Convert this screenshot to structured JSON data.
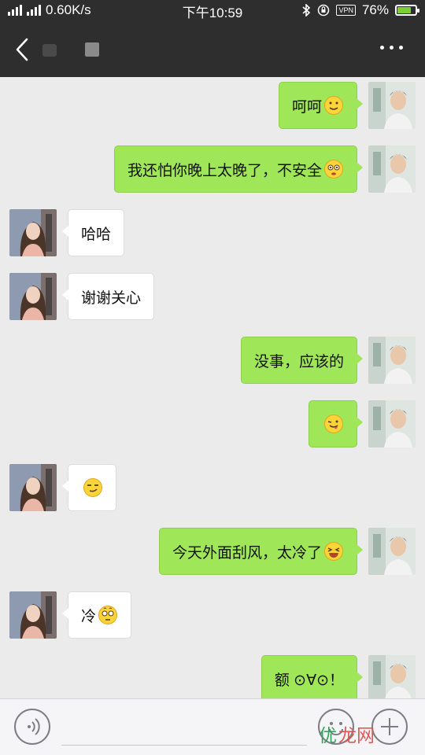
{
  "status_bar": {
    "speed": "0.60K/s",
    "time": "下午10:59",
    "vpn": "VPN",
    "battery": "76%",
    "battery_level": 0.76
  },
  "header": {
    "back_icon": "chevron-left-icon",
    "more_icon": "more-dots-icon"
  },
  "messages": [
    {
      "side": "right",
      "text": "呵呵",
      "emoji": "smile"
    },
    {
      "side": "right",
      "text": "我还怕你晚上太晚了，不安全",
      "emoji": "flushed"
    },
    {
      "side": "left",
      "text": "哈哈",
      "emoji": ""
    },
    {
      "side": "left",
      "text": "谢谢关心",
      "emoji": ""
    },
    {
      "side": "right",
      "text": "没事，应该的",
      "emoji": ""
    },
    {
      "side": "right",
      "text": "",
      "emoji": "tongue-wink"
    },
    {
      "side": "left",
      "text": "",
      "emoji": "smirk"
    },
    {
      "side": "right",
      "text": "今天外面刮风，太冷了",
      "emoji": "laugh"
    },
    {
      "side": "left",
      "text": "冷",
      "emoji": "dizzy"
    },
    {
      "side": "right",
      "text": "额 ⊙∀⊙！",
      "emoji": ""
    }
  ],
  "input_bar": {
    "voice_icon": "voice-icon",
    "emoji_icon": "emoji-icon",
    "plus_icon": "plus-icon"
  },
  "watermark": "优",
  "watermark_rest": "龙网",
  "colors": {
    "self_bubble": "#9fe658",
    "other_bubble": "#ffffff",
    "header": "#2e2e2e",
    "background": "#ebebeb"
  }
}
